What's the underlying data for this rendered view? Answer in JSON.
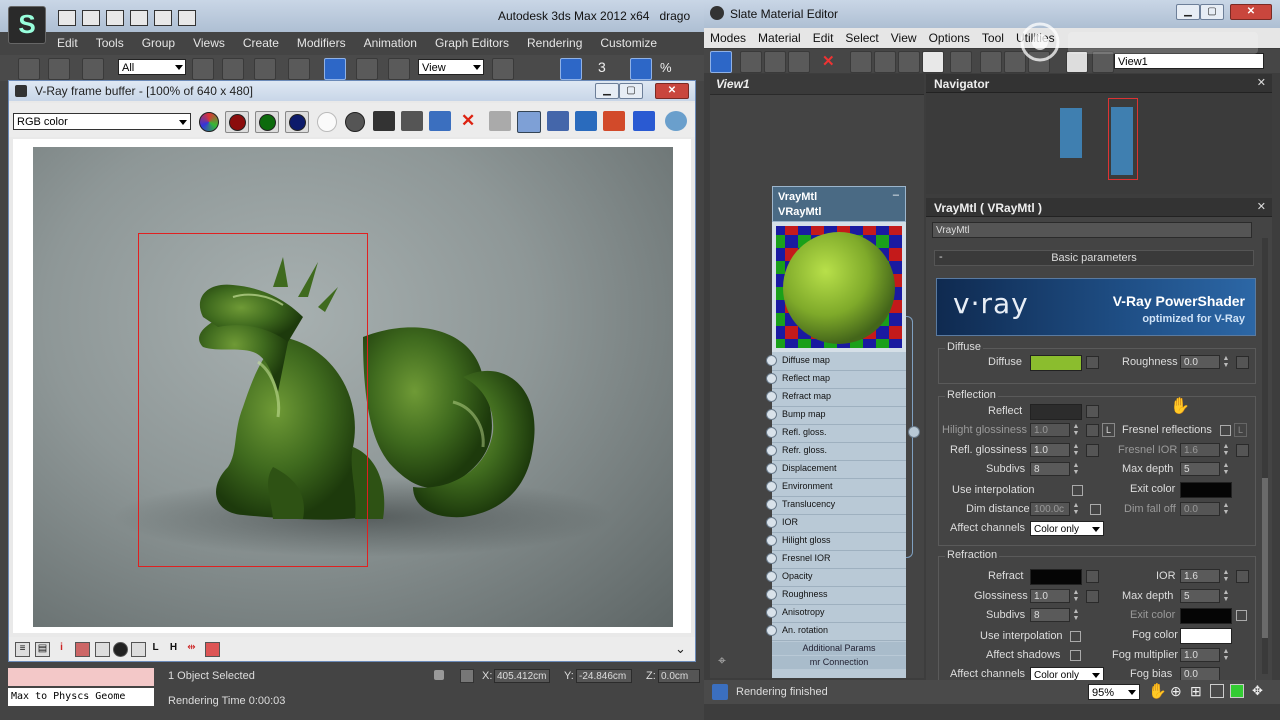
{
  "max": {
    "title": "Autodesk 3ds Max 2012 x64",
    "title_suffix": "drago",
    "menu": [
      "Edit",
      "Tools",
      "Group",
      "Views",
      "Create",
      "Modifiers",
      "Animation",
      "Graph Editors",
      "Rendering",
      "Customize"
    ],
    "selection_filter": "All",
    "ref_coord": "View",
    "snap_label": "3",
    "status_selected": "1 Object Selected",
    "rendering_time": "Rendering Time  0:00:03",
    "script_text": "Max to Physcs Geome",
    "coords": {
      "x_label": "X:",
      "x": "405.412cm",
      "y_label": "Y:",
      "y": "-24.846cm",
      "z_label": "Z:",
      "z": "0.0cm"
    }
  },
  "vfb": {
    "title": "V-Ray frame buffer - [100% of 640 x 480]",
    "channel": "RGB color"
  },
  "sme": {
    "title": "Slate Material Editor",
    "menu": [
      "Modes",
      "Material",
      "Edit",
      "Select",
      "View",
      "Options",
      "Tool",
      "Utilities"
    ],
    "view_combo": "View1",
    "view_tab": "View1",
    "node": {
      "title1": "VrayMtl",
      "title2": "VRayMtl",
      "slots": [
        "Diffuse map",
        "Reflect map",
        "Refract map",
        "Bump map",
        "Refl. gloss.",
        "Refr. gloss.",
        "Displacement",
        "Environment",
        "Translucency",
        "IOR",
        "Hilight gloss",
        "Fresnel IOR",
        "Opacity",
        "Roughness",
        "Anisotropy",
        "An. rotation"
      ],
      "rollout1": "Additional Params",
      "rollout2": "mr Connection"
    },
    "navigator": "Navigator",
    "params_title": "VrayMtl  ( VRayMtl )",
    "material_name": "VrayMtl",
    "basic_params": "Basic parameters",
    "rollout_minus": "-",
    "banner": {
      "brand": "v·ray",
      "title": "V-Ray PowerShader",
      "subtitle": "optimized for V-Ray"
    },
    "diffuse": {
      "group": "Diffuse",
      "label": "Diffuse",
      "color": "#8bbd2e",
      "roughness_label": "Roughness",
      "roughness": "0.0"
    },
    "reflection": {
      "group": "Reflection",
      "reflect_label": "Reflect",
      "hilight_label": "Hilight glossiness",
      "hilight": "1.0",
      "L": "L",
      "fresnel_label": "Fresnel reflections",
      "fresnel_ior_label": "Fresnel IOR",
      "fresnel_ior": "1.6",
      "refl_gloss_label": "Refl. glossiness",
      "refl_gloss": "1.0",
      "subdivs_label": "Subdivs",
      "subdivs": "8",
      "max_depth_label": "Max depth",
      "max_depth": "5",
      "use_interp_label": "Use interpolation",
      "exit_color_label": "Exit color",
      "dim_distance_label": "Dim distance",
      "dim_distance": "100.0c",
      "dim_falloff_label": "Dim fall off",
      "dim_falloff": "0.0",
      "affect_channels_label": "Affect channels",
      "affect_channels": "Color only"
    },
    "refraction": {
      "group": "Refraction",
      "refract_label": "Refract",
      "ior_label": "IOR",
      "ior": "1.6",
      "gloss_label": "Glossiness",
      "gloss": "1.0",
      "max_depth_label": "Max depth",
      "max_depth": "5",
      "subdivs_label": "Subdivs",
      "subdivs": "8",
      "exit_color_label": "Exit color",
      "use_interp_label": "Use interpolation",
      "fog_color_label": "Fog color",
      "affect_shadows_label": "Affect shadows",
      "fog_mult_label": "Fog multiplier",
      "fog_mult": "1.0",
      "fog_bias_label": "Fog bias",
      "fog_bias": "0.0",
      "affect_channels_label": "Affect channels",
      "affect_channels": "Color only"
    },
    "status": "Rendering finished",
    "zoom": "95%"
  }
}
